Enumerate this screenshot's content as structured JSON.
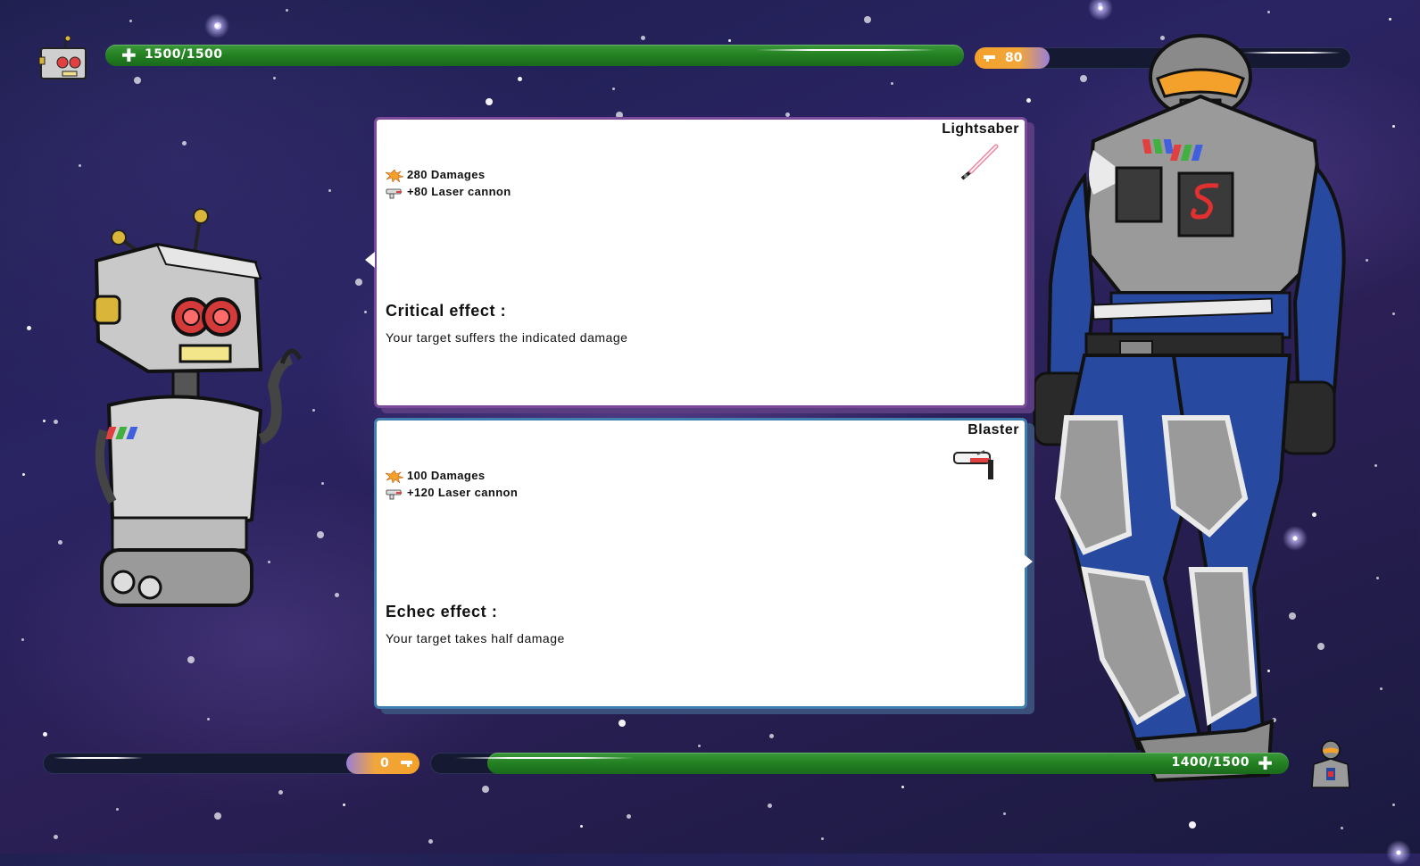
{
  "player": {
    "hp_text": "1500/1500",
    "hp_fraction": 1.0,
    "ammo_text": "80",
    "ammo_fraction": 0.2
  },
  "enemy": {
    "hp_text": "1400/1500",
    "hp_fraction": 0.933,
    "ammo_text": "0",
    "ammo_fraction": 0.0
  },
  "cards": [
    {
      "title": "Lightsaber",
      "weapon_icon": "lightsaber-icon",
      "damage_text": "280 Damages",
      "laser_text": "+80 Laser cannon",
      "effect_title": "Critical effect :",
      "effect_desc": "Your target suffers the indicated damage",
      "border_color": "#7b4a9a"
    },
    {
      "title": "Blaster",
      "weapon_icon": "blaster-icon",
      "damage_text": "100 Damages",
      "laser_text": "+120 Laser cannon",
      "effect_title": "Echec effect :",
      "effect_desc": "Your target takes half damage",
      "border_color": "#3f7fb0"
    }
  ],
  "colors": {
    "hp_green": "#238022",
    "ammo_orange": "#f3a12a",
    "space_bg": "#2a2463"
  }
}
